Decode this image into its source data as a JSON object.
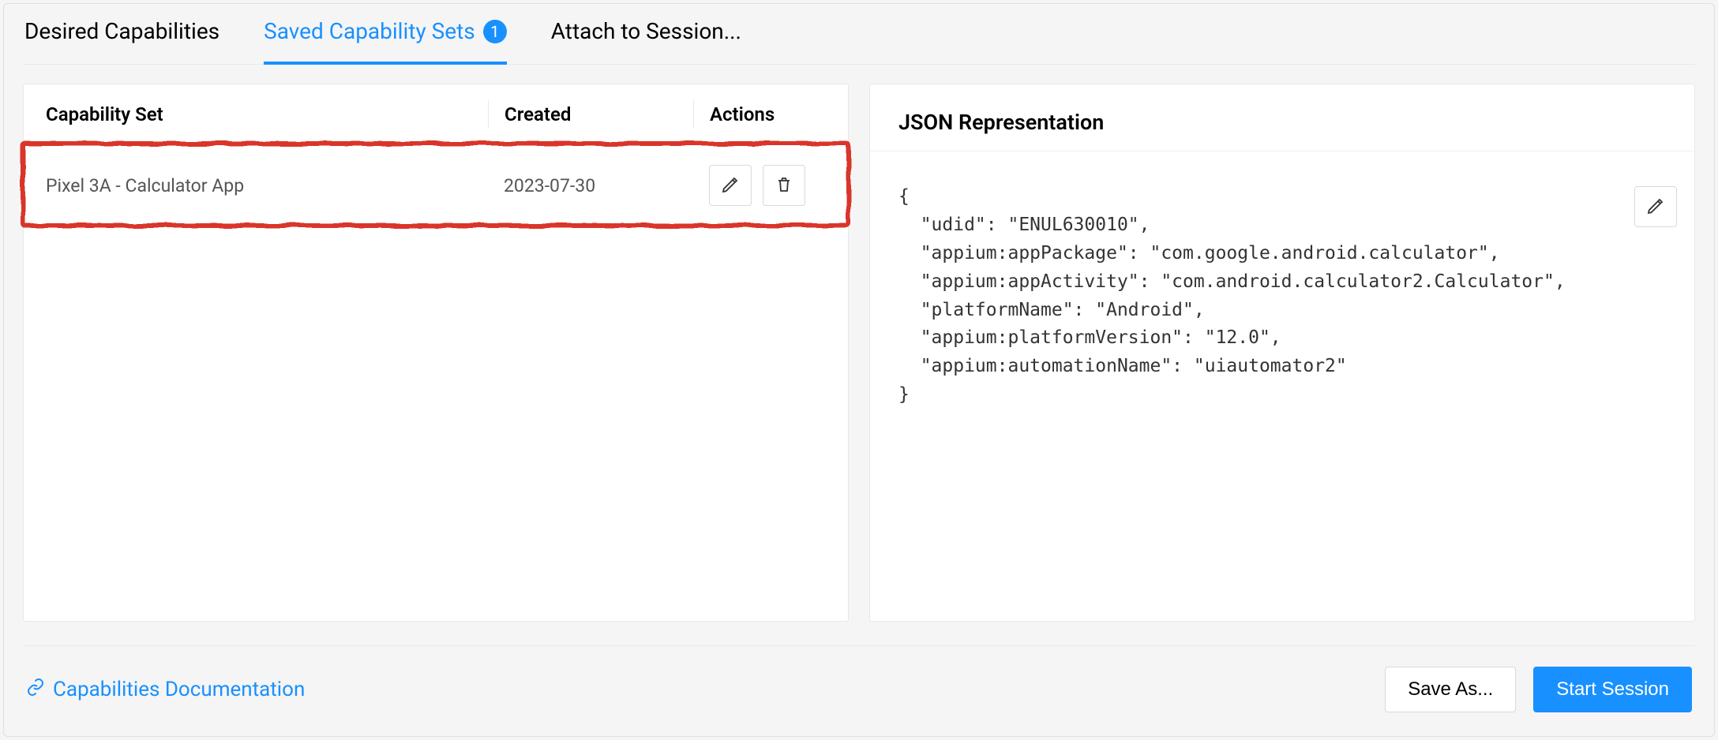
{
  "tabs": {
    "desired": "Desired Capabilities",
    "saved": "Saved Capability Sets",
    "saved_count": "1",
    "attach": "Attach to Session..."
  },
  "table": {
    "headers": {
      "capability_set": "Capability Set",
      "created": "Created",
      "actions": "Actions"
    },
    "rows": [
      {
        "name": "Pixel 3A - Calculator App",
        "created": "2023-07-30"
      }
    ]
  },
  "json_panel": {
    "title": "JSON Representation",
    "code": "{\n  \"udid\": \"ENUL630010\",\n  \"appium:appPackage\": \"com.google.android.calculator\",\n  \"appium:appActivity\": \"com.android.calculator2.Calculator\",\n  \"platformName\": \"Android\",\n  \"appium:platformVersion\": \"12.0\",\n  \"appium:automationName\": \"uiautomator2\"\n}"
  },
  "footer": {
    "doc_link": "Capabilities Documentation",
    "save_as": "Save As...",
    "start_session": "Start Session"
  }
}
